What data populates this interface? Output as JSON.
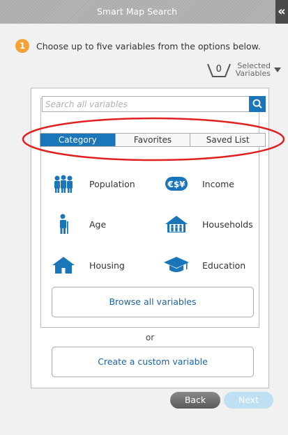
{
  "header": {
    "title": "Smart Map Search",
    "collapse_glyph": "«",
    "collapse_icon": "double-chevron-left-icon"
  },
  "step": {
    "number": "1",
    "instruction": "Choose up to five variables from the options below."
  },
  "selected": {
    "count": "0",
    "label_line1": "Selected",
    "label_line2": "Variables"
  },
  "search": {
    "placeholder": "Search all variables",
    "value": "",
    "icon": "search-icon"
  },
  "tabs": [
    {
      "label": "Category",
      "active": true
    },
    {
      "label": "Favorites",
      "active": false
    },
    {
      "label": "Saved List",
      "active": false
    }
  ],
  "categories": [
    {
      "label": "Population",
      "icon": "people-group-icon"
    },
    {
      "label": "Income",
      "icon": "currency-icon"
    },
    {
      "label": "Age",
      "icon": "person-icon"
    },
    {
      "label": "Households",
      "icon": "household-icon"
    },
    {
      "label": "Housing",
      "icon": "house-icon"
    },
    {
      "label": "Education",
      "icon": "graduation-cap-icon"
    }
  ],
  "browse_label": "Browse all variables",
  "or_label": "or",
  "custom_label": "Create a custom variable",
  "buttons": {
    "back": "Back",
    "next": "Next"
  },
  "colors": {
    "accent": "#1b75b9",
    "step_badge": "#f4a236",
    "annotation_oval": "#e0201f",
    "next_disabled": "#bfdff2"
  }
}
